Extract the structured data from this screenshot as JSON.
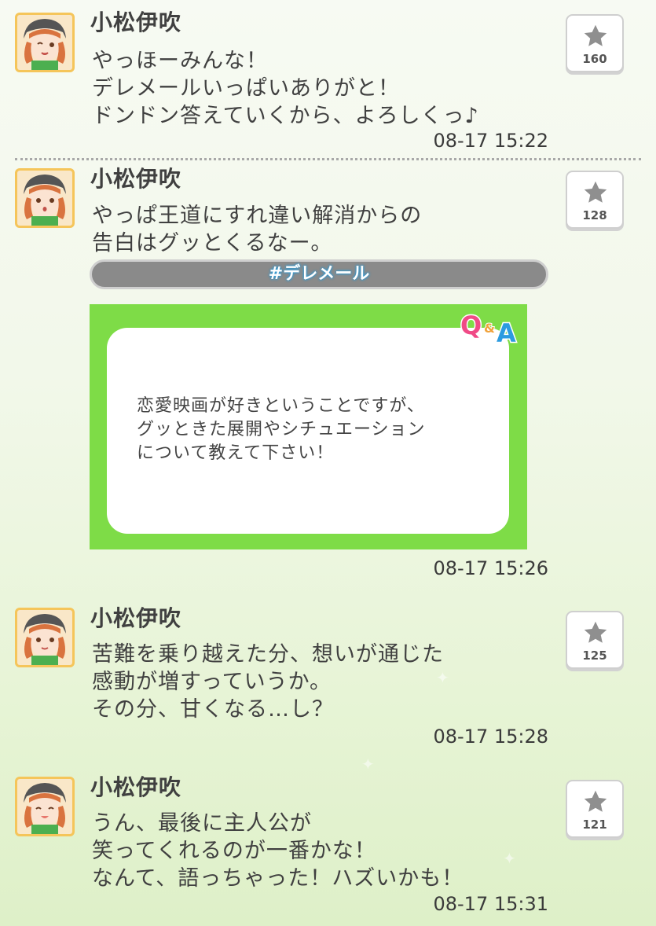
{
  "posts": [
    {
      "author": "小松伊吹",
      "lines": [
        "やっほーみんな！",
        "デレメールいっぱいありがと！",
        "ドンドン答えていくから、よろしくっ♪"
      ],
      "time": "08-17 15:22",
      "fav_count": "160"
    },
    {
      "author": "小松伊吹",
      "lines": [
        "やっぱ王道にすれ違い解消からの",
        "告白はグッとくるなー。"
      ],
      "hashtag": "#デレメール",
      "qa_card": {
        "logo": "Q&A",
        "question_lines": [
          "恋愛映画が好きということですが、",
          "グッときた展開やシチュエーション",
          "について教えて下さい！"
        ]
      },
      "time": "08-17 15:26",
      "fav_count": "128"
    },
    {
      "author": "小松伊吹",
      "lines": [
        "苦難を乗り越えた分、想いが通じた",
        "感動が増すっていうか。",
        "その分、甘くなる…し？"
      ],
      "time": "08-17 15:28",
      "fav_count": "125"
    },
    {
      "author": "小松伊吹",
      "lines": [
        "うん、最後に主人公が",
        "笑ってくれるのが一番かな！",
        "なんて、語っちゃった！ハズいかも！"
      ],
      "time": "08-17 15:31",
      "fav_count": "121"
    }
  ],
  "colors": {
    "qa_green": "#7edc47",
    "tag_gray": "#8a8a8a",
    "tag_glow": "#2a9bd8",
    "star_gray": "#8f8f8f",
    "avatar_frame": "#f3b84a"
  },
  "icons": {
    "favorite": "star-icon",
    "avatar": "idol-avatar-icon"
  }
}
